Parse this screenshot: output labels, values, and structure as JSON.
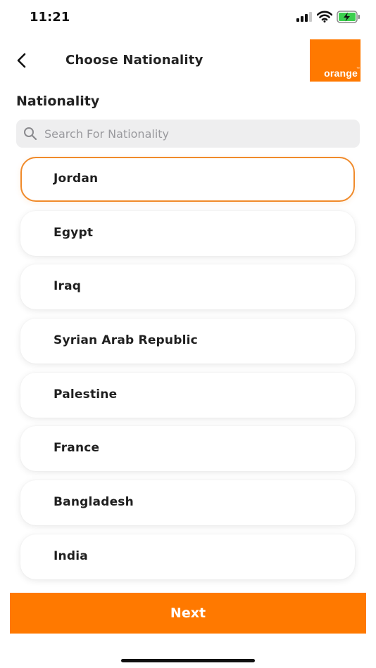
{
  "status_bar": {
    "time": "11:21",
    "icons": [
      "signal-icon",
      "wifi-icon",
      "battery-charging-icon"
    ]
  },
  "header": {
    "back_icon": "chevron-left-icon",
    "title": "Choose Nationality",
    "logo_text": "orange",
    "logo_tm": "™"
  },
  "colors": {
    "brand": "#ff7900",
    "selected_border": "#f08a2a",
    "search_bg": "#eeeeef"
  },
  "section_label": "Nationality",
  "search": {
    "placeholder": "Search For Nationality",
    "value": ""
  },
  "nationalities": [
    {
      "label": "Jordan",
      "selected": true
    },
    {
      "label": "Egypt",
      "selected": false
    },
    {
      "label": "Iraq",
      "selected": false
    },
    {
      "label": "Syrian Arab Republic",
      "selected": false
    },
    {
      "label": "Palestine",
      "selected": false
    },
    {
      "label": "France",
      "selected": false
    },
    {
      "label": "Bangladesh",
      "selected": false
    },
    {
      "label": "India",
      "selected": false
    }
  ],
  "footer": {
    "next_label": "Next"
  }
}
